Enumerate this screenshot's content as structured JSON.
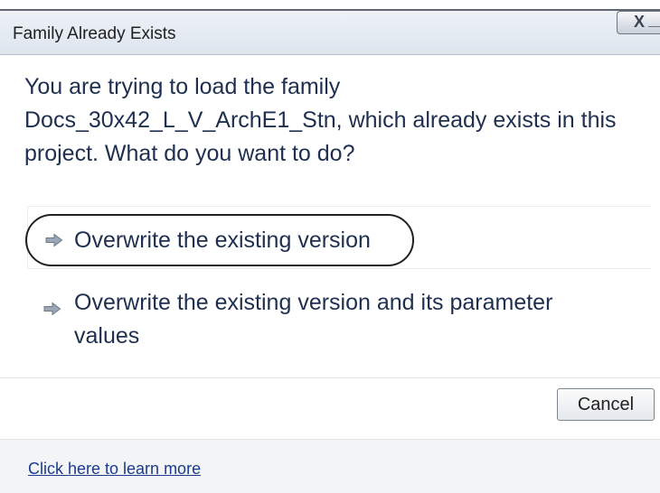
{
  "dialog": {
    "title": "Family Already Exists",
    "close_label": "X",
    "main_instruction": "You are trying to load the family Docs_30x42_L_V_ArchE1_Stn, which already exists in this project.  What do you want to do?",
    "commands": [
      {
        "label": "Overwrite the existing version",
        "icon": "arrow-right-icon"
      },
      {
        "label": "Overwrite the existing version and its parameter values",
        "icon": "arrow-right-icon"
      }
    ],
    "cancel_label": "Cancel",
    "footer_link": "Click here to learn more"
  }
}
